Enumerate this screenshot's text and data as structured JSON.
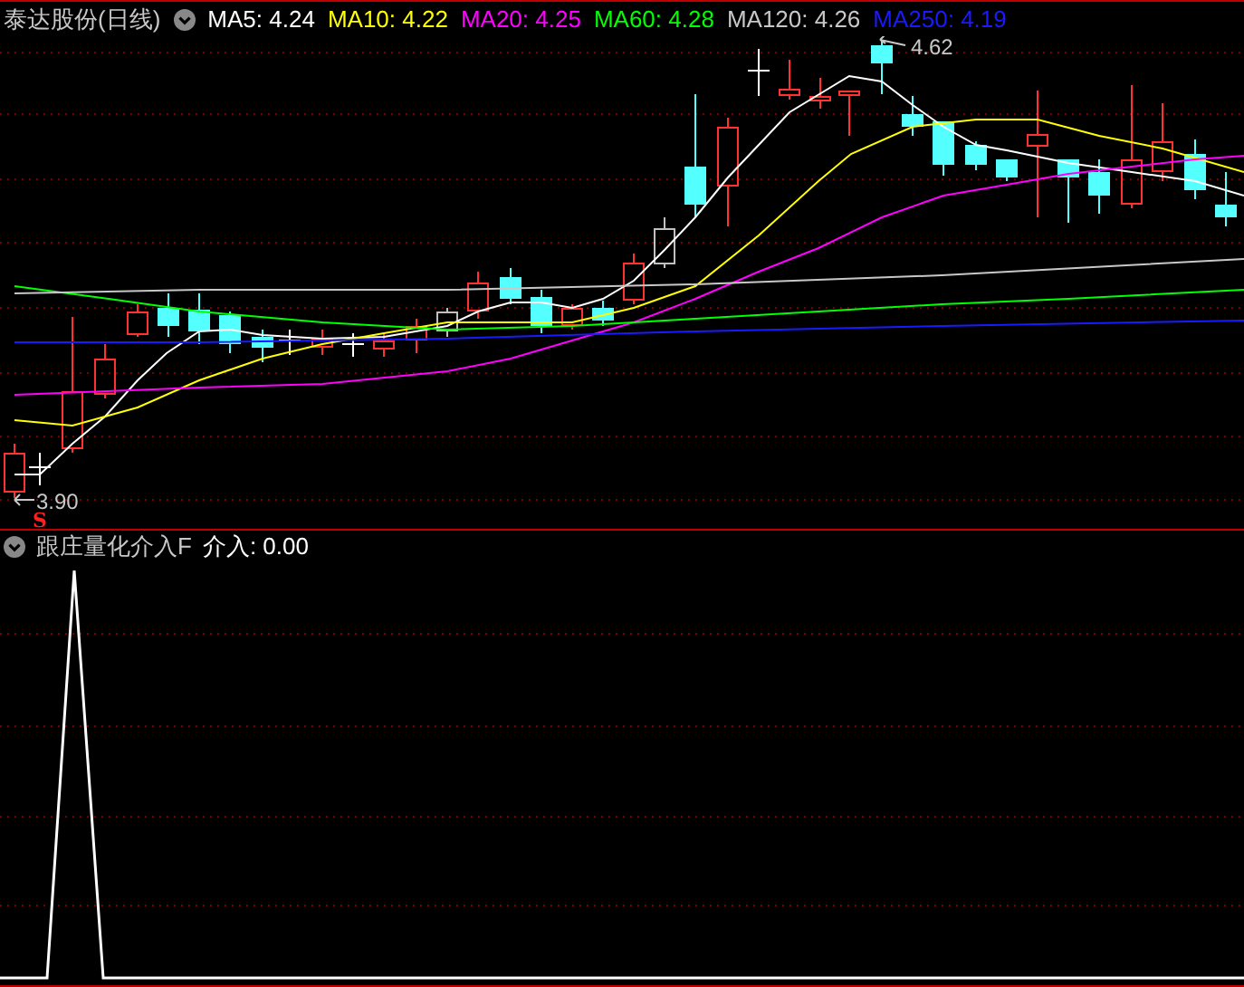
{
  "title": "泰达股份(日线)",
  "indicators": [
    {
      "label": "MA5: 4.24",
      "color": "#ffffff"
    },
    {
      "label": "MA10: 4.22",
      "color": "#ffff00"
    },
    {
      "label": "MA20: 4.25",
      "color": "#ff00ff"
    },
    {
      "label": "MA60: 4.28",
      "color": "#00ff00"
    },
    {
      "label": "MA120: 4.26",
      "color": "#c8c8c8"
    },
    {
      "label": "MA250: 4.19",
      "color": "#1a1aff"
    }
  ],
  "price_labels": {
    "high": "4.62",
    "low": "3.90"
  },
  "signal": "S",
  "lower_panel": {
    "title": "跟庄量化介入F",
    "readings": [
      {
        "label": "介入: 0.00",
        "color": "#ffffff"
      }
    ]
  }
}
